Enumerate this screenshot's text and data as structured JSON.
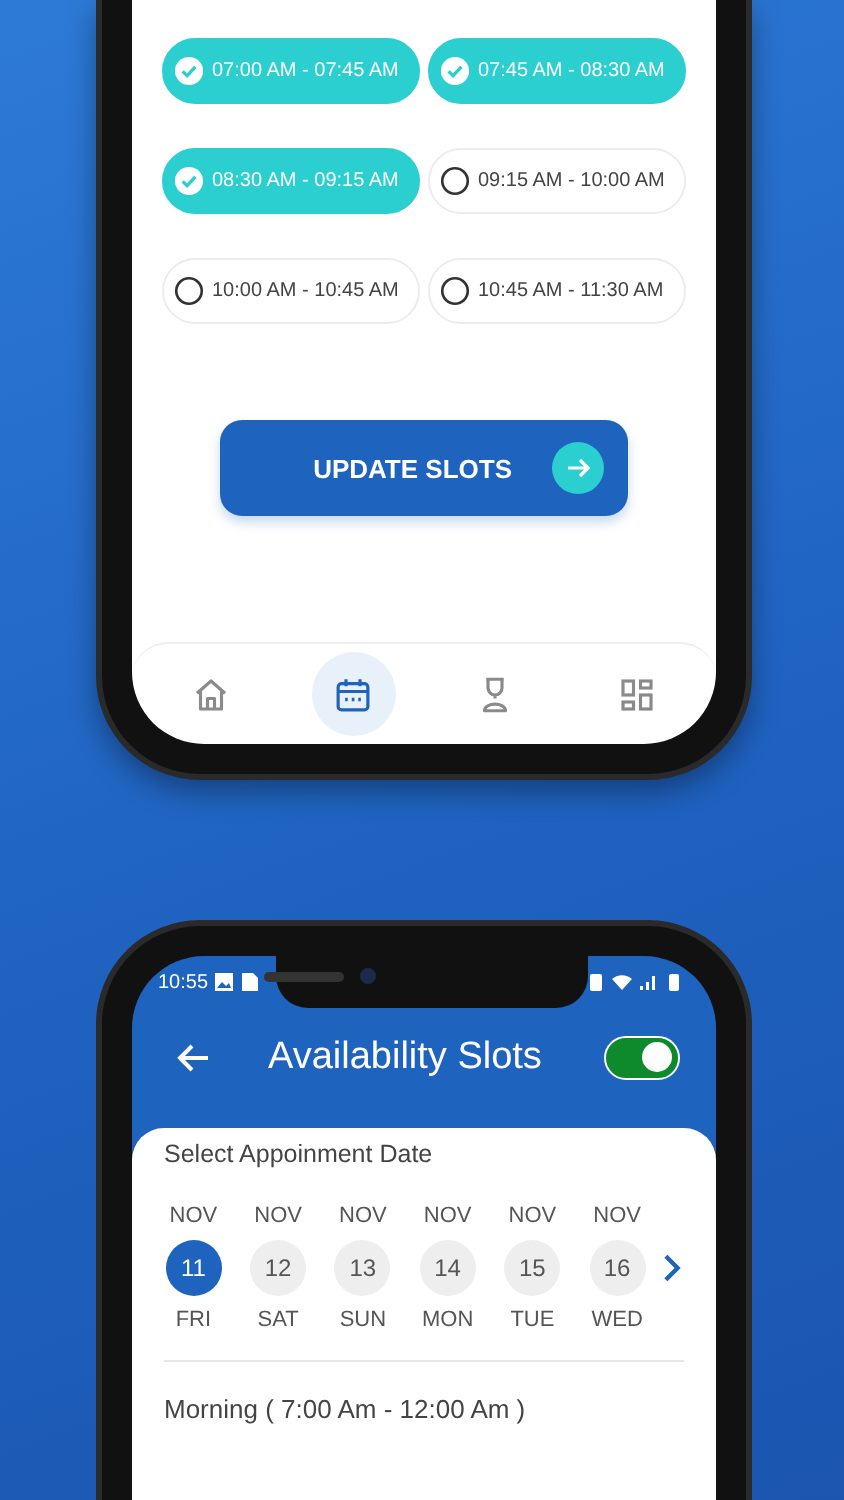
{
  "slots_screen": {
    "slots": [
      {
        "label": "07:00 AM - 07:45 AM",
        "selected": true
      },
      {
        "label": "07:45 AM - 08:30 AM",
        "selected": true
      },
      {
        "label": "08:30 AM - 09:15 AM",
        "selected": true
      },
      {
        "label": "09:15 AM - 10:00 AM",
        "selected": false
      },
      {
        "label": "10:00 AM - 10:45 AM",
        "selected": false
      },
      {
        "label": "10:45 AM - 11:30 AM",
        "selected": false
      }
    ],
    "update_button": {
      "label": "UPDATE SLOTS"
    },
    "nav": [
      {
        "kind": "home",
        "selected": false
      },
      {
        "kind": "calendar",
        "selected": true
      },
      {
        "kind": "figure",
        "selected": false
      },
      {
        "kind": "grid",
        "selected": false
      }
    ]
  },
  "availability_screen": {
    "status_bar": {
      "time": "10:55"
    },
    "title": "Availability Slots",
    "toggle": {
      "on": true
    },
    "date_label": "Select Appoinment Date",
    "dates": [
      {
        "month": "NOV",
        "day": "11",
        "weekday": "FRI",
        "selected": true
      },
      {
        "month": "NOV",
        "day": "12",
        "weekday": "SAT",
        "selected": false
      },
      {
        "month": "NOV",
        "day": "13",
        "weekday": "SUN",
        "selected": false
      },
      {
        "month": "NOV",
        "day": "14",
        "weekday": "MON",
        "selected": false
      },
      {
        "month": "NOV",
        "day": "15",
        "weekday": "TUE",
        "selected": false
      },
      {
        "month": "NOV",
        "day": "16",
        "weekday": "WED",
        "selected": false
      }
    ],
    "section": "Morning ( 7:00 Am - 12:00 Am )"
  }
}
